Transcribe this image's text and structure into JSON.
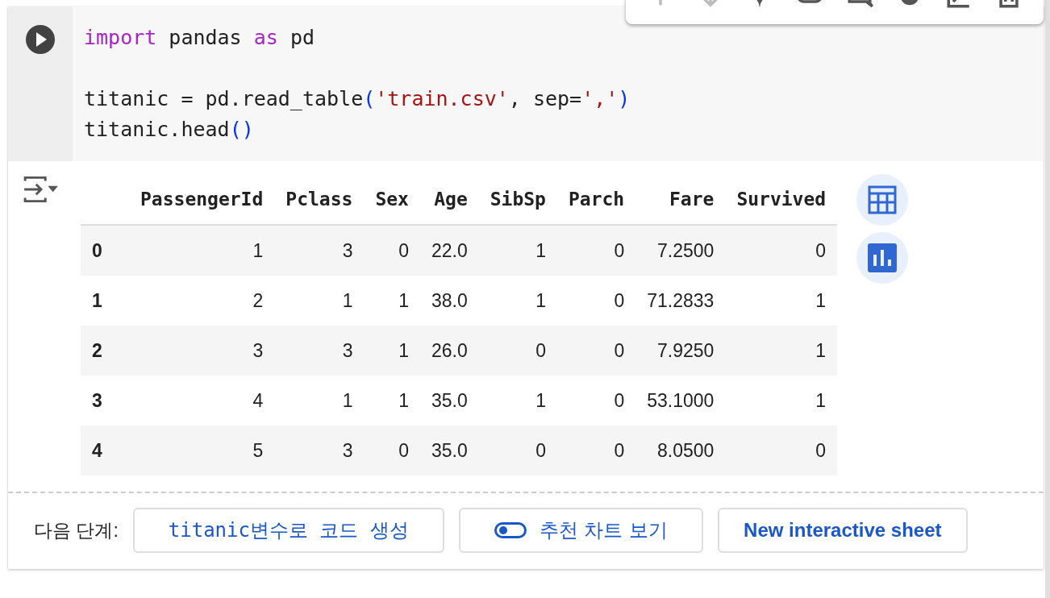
{
  "code_lines": [
    {
      "blank_before": false,
      "tokens": [
        {
          "text": "import",
          "kind": "keyword"
        },
        {
          "text": " pandas ",
          "kind": "plain"
        },
        {
          "text": "as",
          "kind": "keyword"
        },
        {
          "text": " pd",
          "kind": "plain"
        }
      ]
    },
    {
      "blank_before": true,
      "tokens": [
        {
          "text": "titanic = pd.read_table",
          "kind": "plain"
        },
        {
          "text": "(",
          "kind": "paren"
        },
        {
          "text": "'train.csv'",
          "kind": "string"
        },
        {
          "text": ", sep=",
          "kind": "plain"
        },
        {
          "text": "','",
          "kind": "string"
        },
        {
          "text": ")",
          "kind": "paren"
        }
      ]
    },
    {
      "blank_before": false,
      "tokens": [
        {
          "text": "titanic.head",
          "kind": "plain"
        },
        {
          "text": "()",
          "kind": "paren"
        }
      ]
    }
  ],
  "table": {
    "columns": [
      "PassengerId",
      "Pclass",
      "Sex",
      "Age",
      "SibSp",
      "Parch",
      "Fare",
      "Survived"
    ],
    "rows": [
      {
        "index": "0",
        "cells": [
          "1",
          "3",
          "0",
          "22.0",
          "1",
          "0",
          "7.2500",
          "0"
        ]
      },
      {
        "index": "1",
        "cells": [
          "2",
          "1",
          "1",
          "38.0",
          "1",
          "0",
          "71.2833",
          "1"
        ]
      },
      {
        "index": "2",
        "cells": [
          "3",
          "3",
          "1",
          "26.0",
          "0",
          "0",
          "7.9250",
          "1"
        ]
      },
      {
        "index": "3",
        "cells": [
          "4",
          "1",
          "1",
          "35.0",
          "1",
          "0",
          "53.1000",
          "1"
        ]
      },
      {
        "index": "4",
        "cells": [
          "5",
          "3",
          "0",
          "35.0",
          "0",
          "0",
          "8.0500",
          "0"
        ]
      }
    ]
  },
  "next_steps": {
    "label": "다음 단계:",
    "buttons": [
      {
        "label": "titanic변수로 코드 생성",
        "kind": "code"
      },
      {
        "label": "추천 차트 보기",
        "kind": "toggle",
        "on": false
      },
      {
        "label": "New interactive sheet",
        "kind": "plain"
      }
    ]
  }
}
